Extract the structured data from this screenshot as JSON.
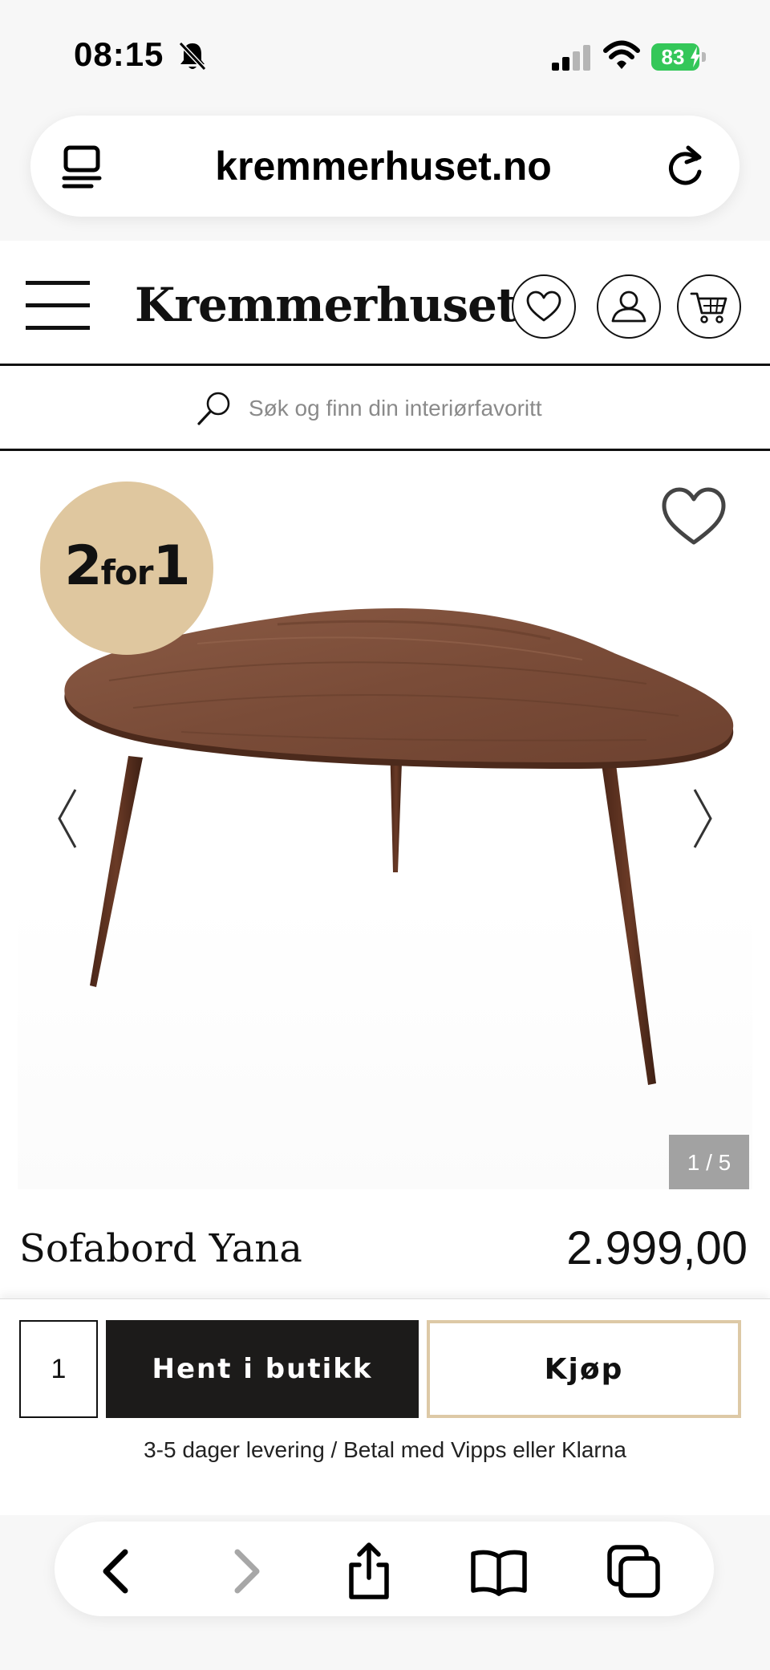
{
  "status_bar": {
    "time": "08:15",
    "battery_level": "83",
    "battery_color": "#34c759",
    "icons": [
      "bell-slash-icon",
      "cellular-signal-icon",
      "wifi-icon",
      "battery-charging-icon"
    ]
  },
  "browser": {
    "url": "kremmerhuset.no",
    "icons": [
      "tabs-overview-icon",
      "reload-icon"
    ]
  },
  "site_header": {
    "brand": "Kremmerhuset",
    "icons": [
      "hamburger-menu-icon",
      "heart-icon",
      "account-icon",
      "cart-icon"
    ]
  },
  "search": {
    "placeholder": "Søk og finn din interiørfavoritt"
  },
  "product": {
    "badge_big_1": "2",
    "badge_small": "for",
    "badge_big_2": "1",
    "badge_color": "#dfc79f",
    "image_counter": "1 / 5",
    "title": "Sofabord Yana",
    "price": "2.999,00"
  },
  "buy_bar": {
    "quantity": "1",
    "pickup_label": "Hent i butikk",
    "buy_label": "Kjøp",
    "buy_border_color": "#ddc9a6",
    "delivery_note": "3-5 dager levering / Betal med Vipps eller Klarna"
  },
  "browser_toolbar": {
    "icons": [
      "back-icon",
      "forward-icon",
      "share-icon",
      "bookmarks-icon",
      "tabs-icon"
    ]
  }
}
